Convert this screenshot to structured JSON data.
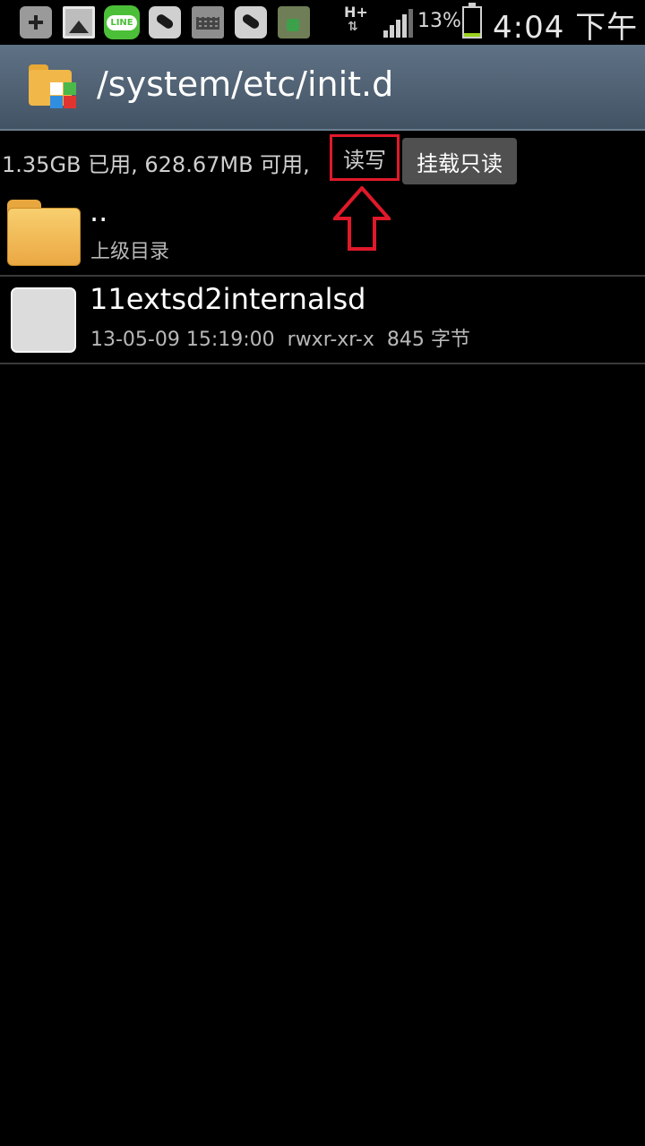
{
  "status_bar": {
    "network": "H+",
    "network_arrows": "⇅",
    "battery_percent": "13%",
    "battery_level": 0.13,
    "time": "4:04 下午",
    "notification_icons": [
      "add-icon",
      "image-icon",
      "line-icon",
      "pea-icon",
      "keyboard-icon",
      "pea-icon",
      "tools-icon"
    ],
    "line_label": "LINE"
  },
  "header": {
    "path": "/system/etc/init.d"
  },
  "storage": {
    "info": "1.35GB 已用, 628.67MB 可用,",
    "mount_state": "读写",
    "mount_button_label": "挂载只读",
    "annotation_color": "#e0192a"
  },
  "files": [
    {
      "name": "..",
      "detail": "上级目录",
      "icon": "folder-icon"
    },
    {
      "name": "11extsd2internalsd",
      "detail": "13-05-09 15:19:00  rwxr-xr-x  845 字节",
      "icon": "file-icon"
    }
  ]
}
